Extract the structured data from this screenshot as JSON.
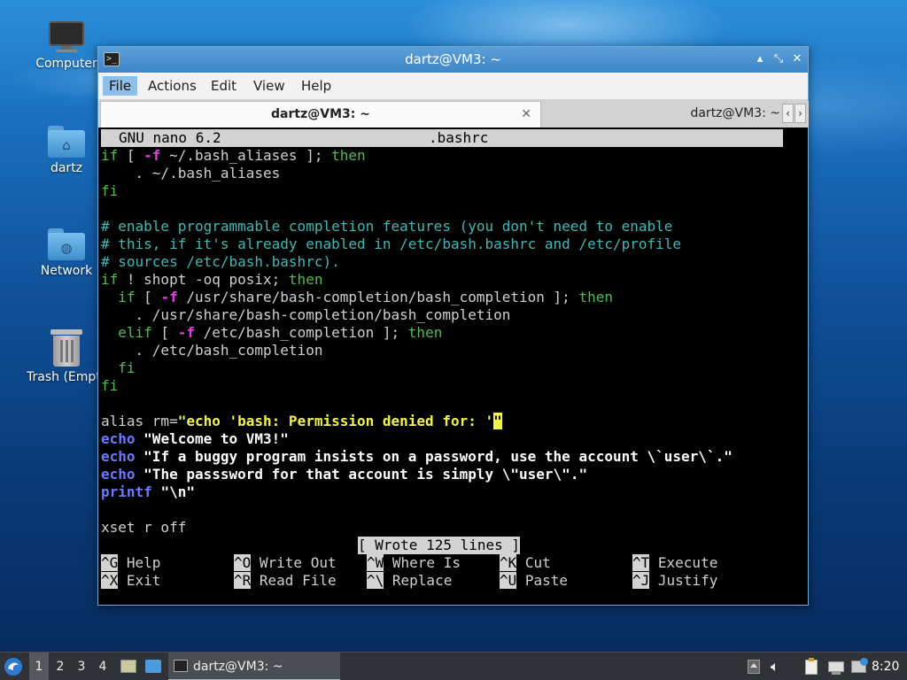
{
  "desktop": {
    "icons": [
      {
        "label": "Computer",
        "icon": "computer-icon"
      },
      {
        "label": "dartz",
        "icon": "home-folder-icon"
      },
      {
        "label": "Network",
        "icon": "network-folder-icon"
      },
      {
        "label": "Trash (Empty)",
        "icon": "trash-icon"
      }
    ]
  },
  "window": {
    "title": "dartz@VM3: ~",
    "controls": {
      "minimize": "▴",
      "maximize": "⤡",
      "close": "✕"
    },
    "menu": [
      "File",
      "Actions",
      "Edit",
      "View",
      "Help"
    ],
    "active_menu": "File",
    "tabs": [
      {
        "label": "dartz@VM3: ~",
        "close": "✕"
      },
      {
        "label": "dartz@VM3: ~"
      }
    ],
    "tab_scroll": {
      "left": "‹",
      "right": "›"
    }
  },
  "nano": {
    "version": "GNU nano 6.2",
    "filename": ".bashrc",
    "status_message": "[ Wrote 125 lines ]",
    "shortcuts": [
      [
        {
          "key": "^G",
          "label": "Help"
        },
        {
          "key": "^O",
          "label": "Write Out"
        },
        {
          "key": "^W",
          "label": "Where Is"
        },
        {
          "key": "^K",
          "label": "Cut"
        },
        {
          "key": "^T",
          "label": "Execute"
        }
      ],
      [
        {
          "key": "^X",
          "label": "Exit"
        },
        {
          "key": "^R",
          "label": "Read File"
        },
        {
          "key": "^\\",
          "label": "Replace"
        },
        {
          "key": "^U",
          "label": "Paste"
        },
        {
          "key": "^J",
          "label": "Justify"
        }
      ]
    ],
    "lines": [
      [
        {
          "t": "if",
          "c": "kw"
        },
        {
          "t": " [ ",
          "c": ""
        },
        {
          "t": "-f",
          "c": "fl"
        },
        {
          "t": " ~/.bash_aliases ]; ",
          "c": ""
        },
        {
          "t": "then",
          "c": "kw"
        }
      ],
      [
        {
          "t": "    . ~/.bash_aliases",
          "c": ""
        }
      ],
      [
        {
          "t": "fi",
          "c": "kw"
        }
      ],
      [],
      [
        {
          "t": "# enable programmable completion features (you don't need to enable",
          "c": "cm"
        }
      ],
      [
        {
          "t": "# this, if it's already enabled in /etc/bash.bashrc and /etc/profile",
          "c": "cm"
        }
      ],
      [
        {
          "t": "# sources /etc/bash.bashrc).",
          "c": "cm"
        }
      ],
      [
        {
          "t": "if",
          "c": "kw"
        },
        {
          "t": " ! shopt -oq posix; ",
          "c": ""
        },
        {
          "t": "then",
          "c": "kw"
        }
      ],
      [
        {
          "t": "  ",
          "c": ""
        },
        {
          "t": "if",
          "c": "kw"
        },
        {
          "t": " [ ",
          "c": ""
        },
        {
          "t": "-f",
          "c": "fl"
        },
        {
          "t": " /usr/share/bash-completion/bash_completion ]; ",
          "c": ""
        },
        {
          "t": "then",
          "c": "kw"
        }
      ],
      [
        {
          "t": "    . /usr/share/bash-completion/bash_completion",
          "c": ""
        }
      ],
      [
        {
          "t": "  ",
          "c": ""
        },
        {
          "t": "elif",
          "c": "kw"
        },
        {
          "t": " [ ",
          "c": ""
        },
        {
          "t": "-f",
          "c": "fl"
        },
        {
          "t": " /etc/bash_completion ]; ",
          "c": ""
        },
        {
          "t": "then",
          "c": "kw"
        }
      ],
      [
        {
          "t": "    . /etc/bash_completion",
          "c": ""
        }
      ],
      [
        {
          "t": "  ",
          "c": ""
        },
        {
          "t": "fi",
          "c": "kw"
        }
      ],
      [
        {
          "t": "fi",
          "c": "kw"
        }
      ],
      [],
      [
        {
          "t": "alias rm=",
          "c": ""
        },
        {
          "t": "\"echo 'bash: Permission denied for: '",
          "c": "st"
        },
        {
          "t": "\"",
          "c": "cur"
        }
      ],
      [
        {
          "t": "echo",
          "c": "bi"
        },
        {
          "t": " ",
          "c": ""
        },
        {
          "t": "\"Welcome to VM3!\"",
          "c": "wt"
        }
      ],
      [
        {
          "t": "echo",
          "c": "bi"
        },
        {
          "t": " ",
          "c": ""
        },
        {
          "t": "\"If a buggy program insists on a password, use the account \\`user\\`.\"",
          "c": "wt"
        }
      ],
      [
        {
          "t": "echo",
          "c": "bi"
        },
        {
          "t": " ",
          "c": ""
        },
        {
          "t": "\"The passsword for that account is simply \\\"user\\\".\"",
          "c": "wt"
        }
      ],
      [
        {
          "t": "printf",
          "c": "bi"
        },
        {
          "t": " ",
          "c": ""
        },
        {
          "t": "\"\\n\"",
          "c": "wt"
        }
      ],
      [],
      [
        {
          "t": "xset r off",
          "c": ""
        }
      ]
    ]
  },
  "taskbar": {
    "workspaces": [
      "1",
      "2",
      "3",
      "4"
    ],
    "active_workspace": "1",
    "task_label": "dartz@VM3: ~",
    "clock": "8:20",
    "tray_icons": [
      "tray-arrow-icon",
      "volume-icon",
      "clipboard-icon",
      "network-icon",
      "update-notifier-icon"
    ]
  }
}
